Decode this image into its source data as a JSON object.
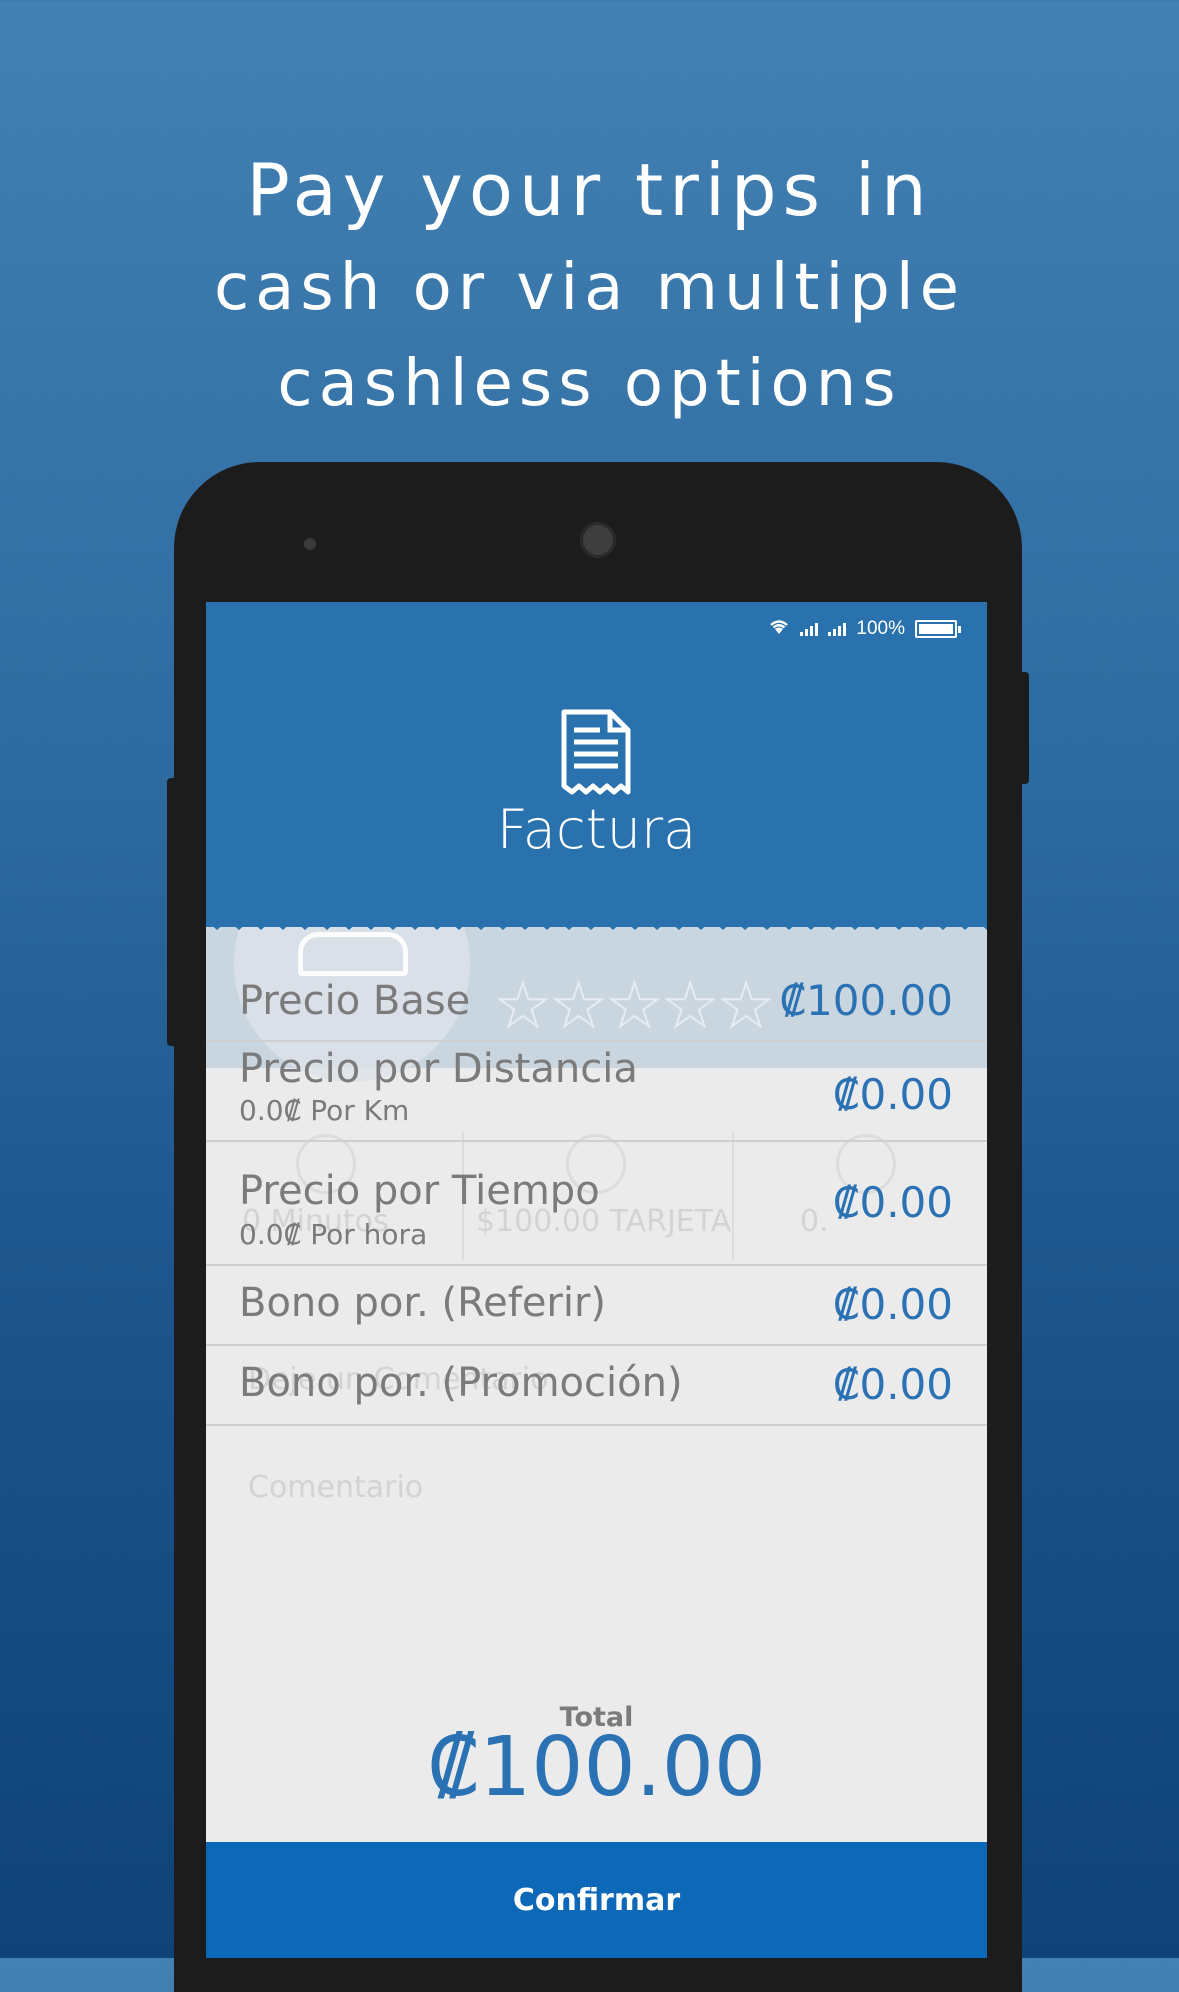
{
  "headline": {
    "line1": "Pay your trips in",
    "line2": "cash or via multiple",
    "line3": "cashless options"
  },
  "status_bar": {
    "battery": "100%"
  },
  "screen": {
    "title": "Factura",
    "rows": [
      {
        "label": "Precio Base",
        "sub": "",
        "value": "₡100.00"
      },
      {
        "label": "Precio por Distancia",
        "sub": "0.0₡ Por Km",
        "value": "₡0.00"
      },
      {
        "label": "Precio por Tiempo",
        "sub": "0.0₡ Por hora",
        "value": "₡0.00"
      },
      {
        "label": "Bono por. (Referir)",
        "sub": "",
        "value": "₡0.00"
      },
      {
        "label": "Bono por. (Promoción)",
        "sub": "",
        "value": "₡0.00"
      }
    ],
    "rating_stars": 5,
    "total_label": "Total",
    "total_value": "₡100.00",
    "confirm_label": "Confirmar",
    "background_faded": {
      "minutes": "0 Minutos",
      "payment": "$100.00 TARJETA",
      "distance": "0.",
      "comment_prompt": "Deje un Comentario",
      "comment_placeholder": "Comentario"
    }
  },
  "colors": {
    "header_blue": "#2a72ad",
    "accent_blue": "#2b72b4",
    "confirm_blue": "#0e68b8",
    "label_gray": "#7b7b7b"
  }
}
